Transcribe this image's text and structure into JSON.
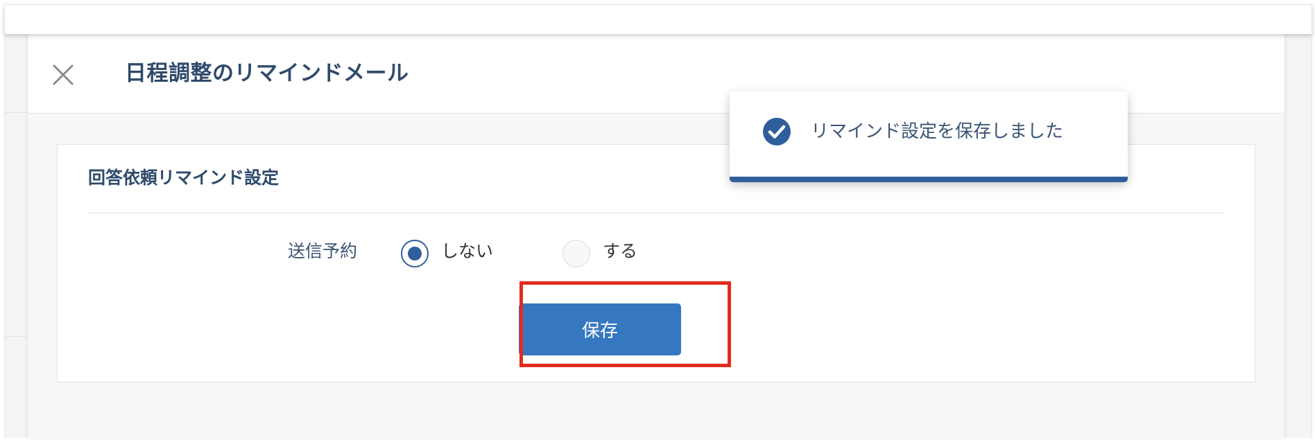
{
  "dialog": {
    "title": "日程調整のリマインドメール",
    "close_icon": "close-icon"
  },
  "card": {
    "title": "回答依頼リマインド設定",
    "schedule": {
      "label": "送信予約",
      "options": [
        {
          "label": "しない",
          "selected": true
        },
        {
          "label": "する",
          "selected": false
        }
      ]
    },
    "save_label": "保存"
  },
  "toast": {
    "icon": "check-circle-icon",
    "message": "リマインド設定を保存しました"
  },
  "colors": {
    "accent": "#3678bf",
    "toast_bar": "#2f5f9b",
    "highlight": "#e32b1e",
    "title_text": "#2f4a6b"
  }
}
